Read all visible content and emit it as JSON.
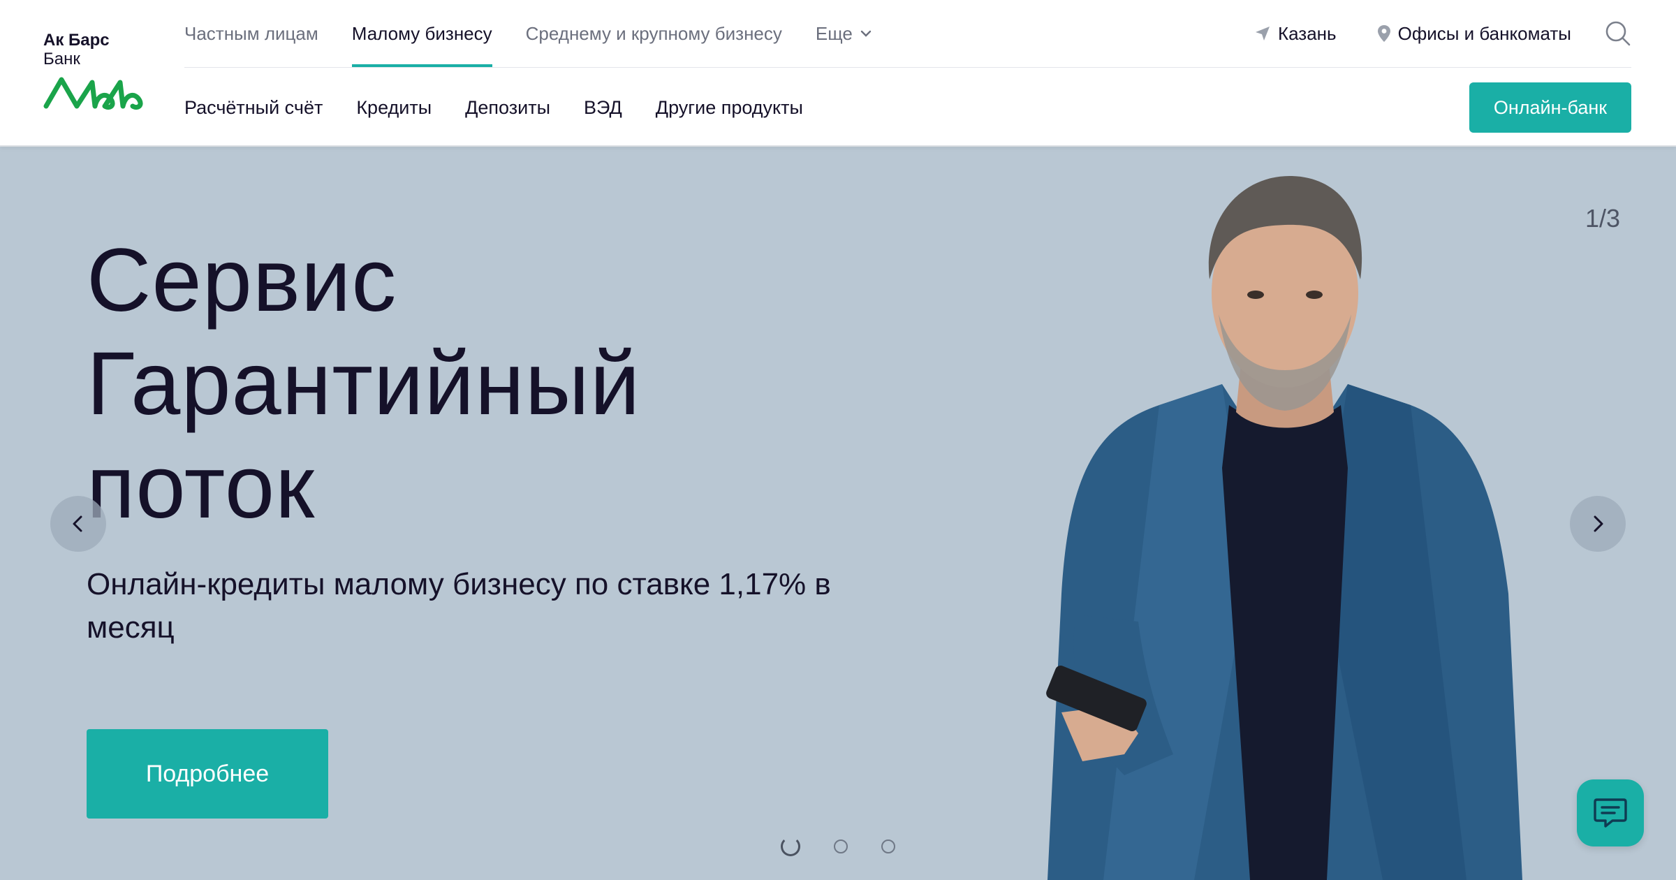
{
  "logo": {
    "line1": "Ак Барс",
    "line2": "Банк",
    "brand_color": "#1aa44a"
  },
  "top_nav": {
    "items": [
      {
        "label": "Частным лицам",
        "active": false
      },
      {
        "label": "Малому бизнесу",
        "active": true
      },
      {
        "label": "Среднему и крупному бизнесу",
        "active": false
      },
      {
        "label": "Еще",
        "active": false,
        "icon": "chevron-down-icon"
      }
    ]
  },
  "top_right": {
    "city": "Казань",
    "offices": "Офисы и банкоматы"
  },
  "sub_nav": {
    "items": [
      "Расчётный счёт",
      "Кредиты",
      "Депозиты",
      "ВЭД",
      "Другие продукты"
    ]
  },
  "online_bank_label": "Онлайн-банк",
  "hero": {
    "title": "Сервис\nГарантийный\nпоток",
    "subtitle": "Онлайн-кредиты малому бизнесу по ставке 1,17% в месяц",
    "button_label": "Подробнее",
    "counter": "1/3",
    "slides_total": 3,
    "active_slide": 1,
    "background": "#b9c7d3"
  },
  "colors": {
    "accent": "#1aafa6",
    "text": "#151129"
  }
}
